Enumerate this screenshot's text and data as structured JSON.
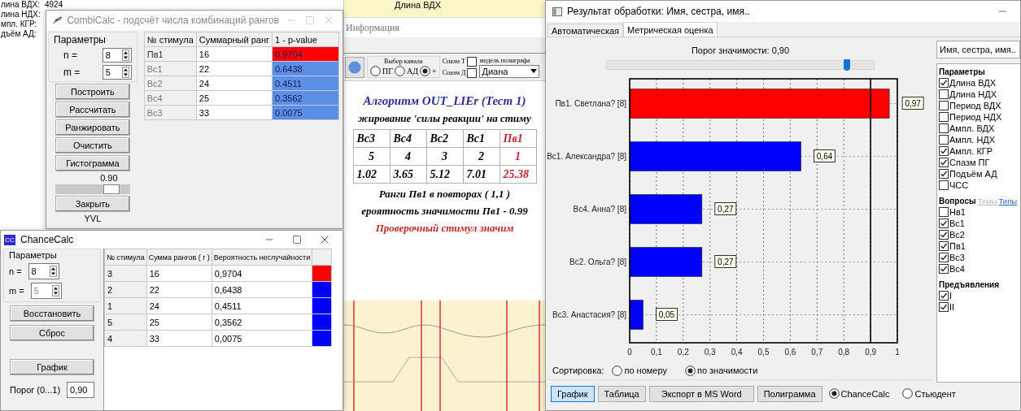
{
  "background_app": {
    "side_readings": [
      {
        "label": "лина ВДХ:",
        "value": "4924"
      },
      {
        "label": "лина НДХ:"
      },
      {
        "label": "мпл. КГР:"
      },
      {
        "label": "дъём АД:"
      }
    ],
    "top_label": "Длина ВДХ",
    "menu": [
      "Информация"
    ],
    "toolbar": {
      "channel_group": {
        "title": "Выбор канала",
        "options": [
          {
            "label": "ПГ",
            "selected": false
          },
          {
            "label": "АД",
            "selected": false
          },
          {
            "label": "+",
            "selected": true
          }
        ]
      },
      "spasm": [
        {
          "label": "Спазм Т",
          "checked": false
        },
        {
          "label": "Спазм Д",
          "checked": false
        }
      ],
      "model": {
        "label": "модель полиграфа",
        "value": "Диана"
      }
    },
    "report": {
      "title": "Алгоритм OUT_LIEr (Тест 1)",
      "subtitle": "жирование 'силы реакции' на стиму",
      "columns": [
        {
          "name": "Вс3",
          "rank": "5",
          "score": "1.02",
          "color": "#000000"
        },
        {
          "name": "Вс4",
          "rank": "4",
          "score": "3.65",
          "color": "#000000"
        },
        {
          "name": "Вс2",
          "rank": "3",
          "score": "5.12",
          "color": "#000000"
        },
        {
          "name": "Вс1",
          "rank": "2",
          "score": "7.01",
          "color": "#000000"
        },
        {
          "name": "Пв1",
          "rank": "1",
          "score": "25.38",
          "color": "#c0282a"
        }
      ],
      "lines": [
        "Ранги Пв1 в повторах ( 1,1 )",
        "ероятность значимости Пв1 - 0.99"
      ],
      "conclusion": "Проверочный стимул значим"
    }
  },
  "combicalc": {
    "title": "CombiCalc - подсчёт числа комбинаций рангов",
    "params_title": "Параметры",
    "params": [
      {
        "label": "n =",
        "value": "8"
      },
      {
        "label": "m =",
        "value": "5"
      }
    ],
    "buttons": [
      "Построить",
      "Рассчитать",
      "Ранжировать",
      "Очистить",
      "Гистограмма"
    ],
    "threshold": {
      "reading": "0.90",
      "level": 0.75
    },
    "close_button": "Закрыть",
    "footer": "YVL",
    "columns": [
      "№ стимула",
      "Суммарный ранг",
      "1 - p-value"
    ],
    "rows": [
      {
        "stimulus": "Пв1",
        "rank": "16",
        "p": "0.9704",
        "color": "#ff0000"
      },
      {
        "stimulus": "Вс1",
        "rank": "22",
        "p": "0.6438",
        "color": "#5b8fe6"
      },
      {
        "stimulus": "Вс2",
        "rank": "24",
        "p": "0.4511",
        "color": "#5b8fe6"
      },
      {
        "stimulus": "Вс4",
        "rank": "25",
        "p": "0.3562",
        "color": "#5b8fe6"
      },
      {
        "stimulus": "Вс3",
        "rank": "33",
        "p": "0.0075",
        "color": "#5b8fe6"
      }
    ]
  },
  "chancecalc": {
    "icon_label": "CC",
    "title": "ChanceCalc",
    "params_title": "Параметры",
    "params": [
      {
        "label": "n =",
        "value": "8",
        "disabled": false
      },
      {
        "label": "m =",
        "value": "5",
        "disabled": true
      }
    ],
    "buttons": [
      "Восстановить",
      "Сброс",
      "График"
    ],
    "threshold": {
      "label": "Порог (0...1)",
      "value": "0,90"
    },
    "columns": [
      "№ стимула",
      "Сумма рангов ( r )",
      "Вероятность неслучайности"
    ],
    "rows": [
      {
        "stimulus": "3",
        "sum": "16",
        "probability": "0,9704",
        "color": "#ff0000"
      },
      {
        "stimulus": "2",
        "sum": "22",
        "probability": "0,6438",
        "color": "#0000ff"
      },
      {
        "stimulus": "1",
        "sum": "24",
        "probability": "0,4511",
        "color": "#0000ff"
      },
      {
        "stimulus": "5",
        "sum": "25",
        "probability": "0,3562",
        "color": "#0000ff"
      },
      {
        "stimulus": "4",
        "sum": "33",
        "probability": "0,0075",
        "color": "#0000ff"
      }
    ]
  },
  "result": {
    "title": "Результат обработки: Имя, сестра, имя..",
    "tabs": [
      {
        "label": "Автоматическая",
        "selected": false
      },
      {
        "label": "Метрическая оценка",
        "selected": true
      }
    ],
    "threshold": {
      "label": "Порог значимости: 0,90",
      "level": 0.9
    },
    "chart": {
      "chart_data": {
        "type": "bar",
        "orientation": "horizontal",
        "grid": true,
        "categories": [
          "Пв1. Светлана? [8]",
          "Вс1. Александра? [8]",
          "Вс4. Анна? [8]",
          "Вс2. Ольга? [8]",
          "Вс3. Анастасия? [8]"
        ],
        "series": [
          {
            "color": "#ff0000",
            "values": [
              0.97,
              null,
              null,
              null,
              null
            ]
          },
          {
            "color": "#0000ff",
            "values": [
              null,
              0.64,
              0.27,
              0.27,
              0.05
            ]
          }
        ],
        "value_labels": [
          "0,97",
          "0,64",
          "0,27",
          "0,27",
          "0,05"
        ],
        "xlim": [
          0,
          1
        ],
        "xticks": [
          0,
          {
            "value": 0.1,
            "label": "0,1"
          },
          {
            "value": 0.2,
            "label": "0,2"
          },
          {
            "value": 0.3,
            "label": "0,3"
          },
          {
            "value": 0.4,
            "label": "0,4"
          },
          {
            "value": 0.5,
            "label": "0,5"
          },
          {
            "value": 0.6,
            "label": "0,6"
          },
          {
            "value": 0.7,
            "label": "0,7"
          },
          {
            "value": 0.8,
            "label": "0,8"
          },
          {
            "value": 0.9,
            "label": "0,9"
          },
          1
        ],
        "ref_lines": [
          {
            "axis": "x",
            "value": 0.9
          }
        ]
      }
    },
    "sort": {
      "label": "Сортировка:",
      "options": [
        {
          "label": "по номеру",
          "selected": false
        },
        {
          "label": "по значимости",
          "selected": true
        }
      ]
    },
    "buttons": [
      {
        "label": "График",
        "selected": true
      },
      {
        "label": "Таблица",
        "selected": false
      },
      {
        "label": "Экспорт в MS Word",
        "selected": false
      },
      {
        "label": "Полиграмма",
        "selected": false
      }
    ],
    "methods": [
      {
        "label": "ChanceCalc",
        "selected": true
      },
      {
        "label": "Стьюдент",
        "selected": false
      }
    ],
    "side": {
      "search": "Имя, сестра, имя..",
      "sections": [
        {
          "title": "Параметры",
          "items": [
            {
              "label": "Длина ВДХ",
              "checked": true
            },
            {
              "label": "Длина НДХ",
              "checked": false
            },
            {
              "label": "Период ВДХ",
              "checked": false
            },
            {
              "label": "Период НДХ",
              "checked": false
            },
            {
              "label": "Ампл. ВДХ",
              "checked": false
            },
            {
              "label": "Ампл. НДХ",
              "checked": false
            },
            {
              "label": "Ампл. КГР",
              "checked": true
            },
            {
              "label": "Спазм ПГ",
              "checked": true
            },
            {
              "label": "Подъём АД",
              "checked": true
            },
            {
              "label": "ЧСС",
              "checked": false
            }
          ]
        },
        {
          "title": "Вопросы",
          "links": [
            {
              "label": "Темы",
              "disabled": true
            },
            {
              "label": "Типы",
              "disabled": false
            }
          ],
          "items": [
            {
              "label": "Нв1",
              "checked": false
            },
            {
              "label": "Вс1",
              "checked": true
            },
            {
              "label": "Вс2",
              "checked": true
            },
            {
              "label": "Пв1",
              "checked": true
            },
            {
              "label": "Вс3",
              "checked": true
            },
            {
              "label": "Вс4",
              "checked": true
            }
          ]
        },
        {
          "title": "Предъявления",
          "items": [
            {
              "label": "I",
              "checked": true
            },
            {
              "label": "II",
              "checked": true
            }
          ]
        }
      ]
    }
  }
}
